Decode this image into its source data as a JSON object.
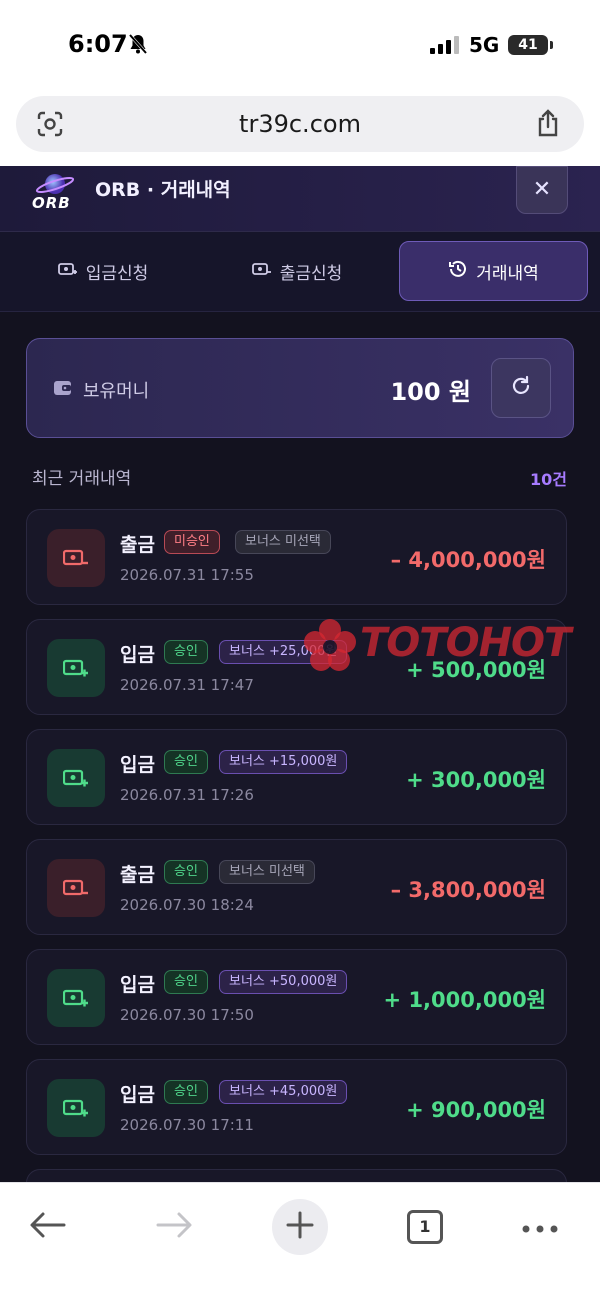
{
  "status_bar": {
    "time": "6:07",
    "network": "5G",
    "battery": "41"
  },
  "browser": {
    "url": "tr39c.com",
    "tab_count": "1"
  },
  "app": {
    "logo_text": "ORB",
    "title": "ORB · 거래내역",
    "close_label": "✕"
  },
  "tabs": [
    {
      "label": "입금신청",
      "active": false
    },
    {
      "label": "출금신청",
      "active": false
    },
    {
      "label": "거래내역",
      "active": true
    }
  ],
  "balance": {
    "label": "보유머니",
    "amount": "100 원"
  },
  "section": {
    "title": "최근 거래내역",
    "count": "10건"
  },
  "watermark": {
    "text": "TOTOHOT"
  },
  "transactions": [
    {
      "type": "출금",
      "status": "미승인",
      "bonus": "보너스 미선택",
      "date": "2026.07.31 17:55",
      "amount": "– 4,000,000원",
      "direction": "out"
    },
    {
      "type": "입금",
      "status": "승인",
      "bonus": "보너스 +25,000원",
      "date": "2026.07.31 17:47",
      "amount": "+ 500,000원",
      "direction": "in"
    },
    {
      "type": "입금",
      "status": "승인",
      "bonus": "보너스 +15,000원",
      "date": "2026.07.31 17:26",
      "amount": "+ 300,000원",
      "direction": "in"
    },
    {
      "type": "출금",
      "status": "승인",
      "bonus": "보너스 미선택",
      "date": "2026.07.30 18:24",
      "amount": "– 3,800,000원",
      "direction": "out"
    },
    {
      "type": "입금",
      "status": "승인",
      "bonus": "보너스 +50,000원",
      "date": "2026.07.30 17:50",
      "amount": "+ 1,000,000원",
      "direction": "in"
    },
    {
      "type": "입금",
      "status": "승인",
      "bonus": "보너스 +45,000원",
      "date": "2026.07.30 17:11",
      "amount": "+ 900,000원",
      "direction": "in"
    }
  ]
}
